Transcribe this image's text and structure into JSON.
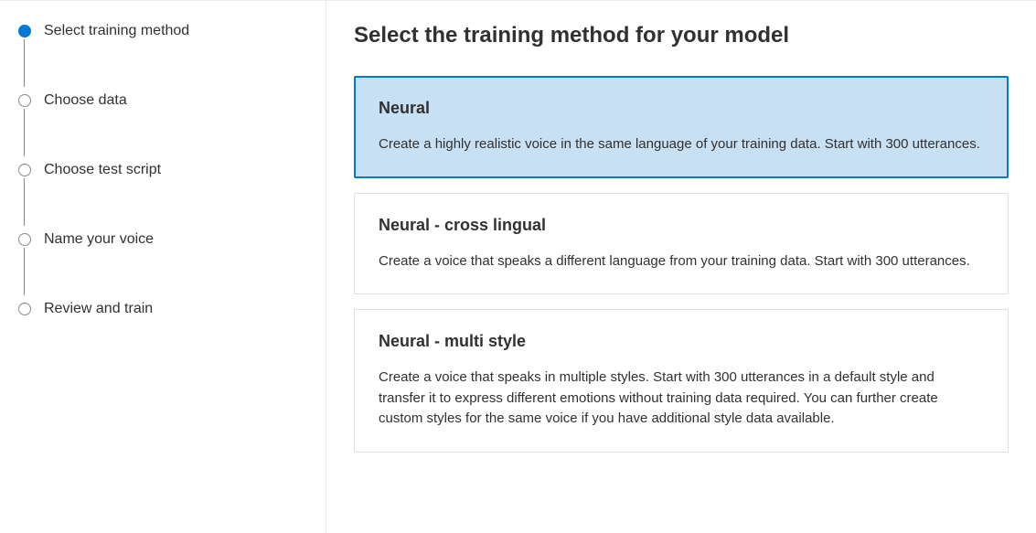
{
  "sidebar": {
    "steps": [
      {
        "label": "Select training method",
        "active": true
      },
      {
        "label": "Choose data",
        "active": false
      },
      {
        "label": "Choose test script",
        "active": false
      },
      {
        "label": "Name your voice",
        "active": false
      },
      {
        "label": "Review and train",
        "active": false
      }
    ]
  },
  "main": {
    "title": "Select the training method for your model",
    "options": [
      {
        "title": "Neural",
        "description": "Create a highly realistic voice in the same language of your training data. Start with 300 utterances.",
        "selected": true
      },
      {
        "title": "Neural - cross lingual",
        "description": "Create a voice that speaks a different language from your training data. Start with 300 utterances.",
        "selected": false
      },
      {
        "title": "Neural - multi style",
        "description": "Create a voice that speaks in multiple styles. Start with 300 utterances in a default style and transfer it to express different emotions without training data required. You can further create custom styles for the same voice if you have additional style data available.",
        "selected": false
      }
    ]
  }
}
